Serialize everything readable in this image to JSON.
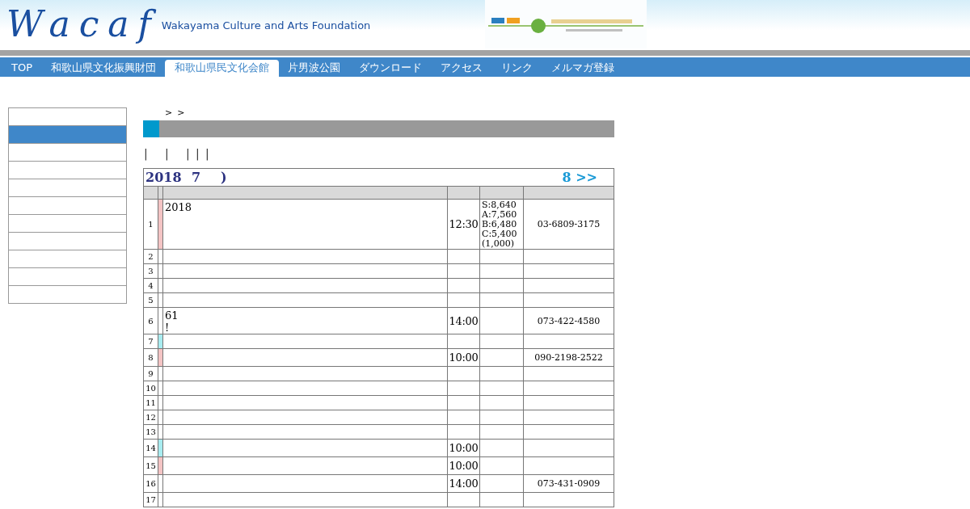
{
  "header": {
    "logo": "Wacaf",
    "subtitle": "Wakayama Culture and Arts Foundation"
  },
  "nav": [
    {
      "label": "TOP",
      "selected": false
    },
    {
      "label": "和歌山県文化振興財団",
      "selected": false
    },
    {
      "label": "和歌山県民文化会館",
      "selected": true
    },
    {
      "label": "片男波公園",
      "selected": false
    },
    {
      "label": "ダウンロード",
      "selected": false
    },
    {
      "label": "アクセス",
      "selected": false
    },
    {
      "label": "リンク",
      "selected": false
    },
    {
      "label": "メルマガ登録",
      "selected": false
    }
  ],
  "sidebar": {
    "items": [
      {
        "selected": false
      },
      {
        "selected": true
      },
      {
        "selected": false
      },
      {
        "selected": false
      },
      {
        "selected": false
      },
      {
        "selected": false
      },
      {
        "selected": false
      },
      {
        "selected": false
      },
      {
        "selected": false
      },
      {
        "selected": false
      },
      {
        "selected": false
      }
    ]
  },
  "breadcrumb": [
    ">",
    ">"
  ],
  "separators": [
    "|",
    "|",
    "|",
    "|",
    "|"
  ],
  "calendar": {
    "year": "2018",
    "month": "7",
    "close": ")",
    "next": "8 >>",
    "rows": [
      {
        "day": "1",
        "color": "#f4c4c4",
        "event": "2018",
        "time": "12:30",
        "price": "S:8,640\nA:7,560\nB:6,480\nC:5,400\n(1,000)",
        "phone": "03-6809-3175"
      },
      {
        "day": "2"
      },
      {
        "day": "3"
      },
      {
        "day": "4"
      },
      {
        "day": "5"
      },
      {
        "day": "6",
        "event": "61\n!",
        "time": "14:00",
        "phone": "073-422-4580"
      },
      {
        "day": "7",
        "color": "#a8ecf0"
      },
      {
        "day": "8",
        "color": "#f4c4c4",
        "time": "10:00",
        "phone": "090-2198-2522"
      },
      {
        "day": "9"
      },
      {
        "day": "10"
      },
      {
        "day": "11"
      },
      {
        "day": "12"
      },
      {
        "day": "13"
      },
      {
        "day": "14",
        "color": "#a8ecf0",
        "time": "10:00"
      },
      {
        "day": "15",
        "color": "#f4c4c4",
        "time": "10:00"
      },
      {
        "day": "16",
        "time": "14:00",
        "phone": "073-431-0909"
      },
      {
        "day": "17"
      }
    ]
  }
}
